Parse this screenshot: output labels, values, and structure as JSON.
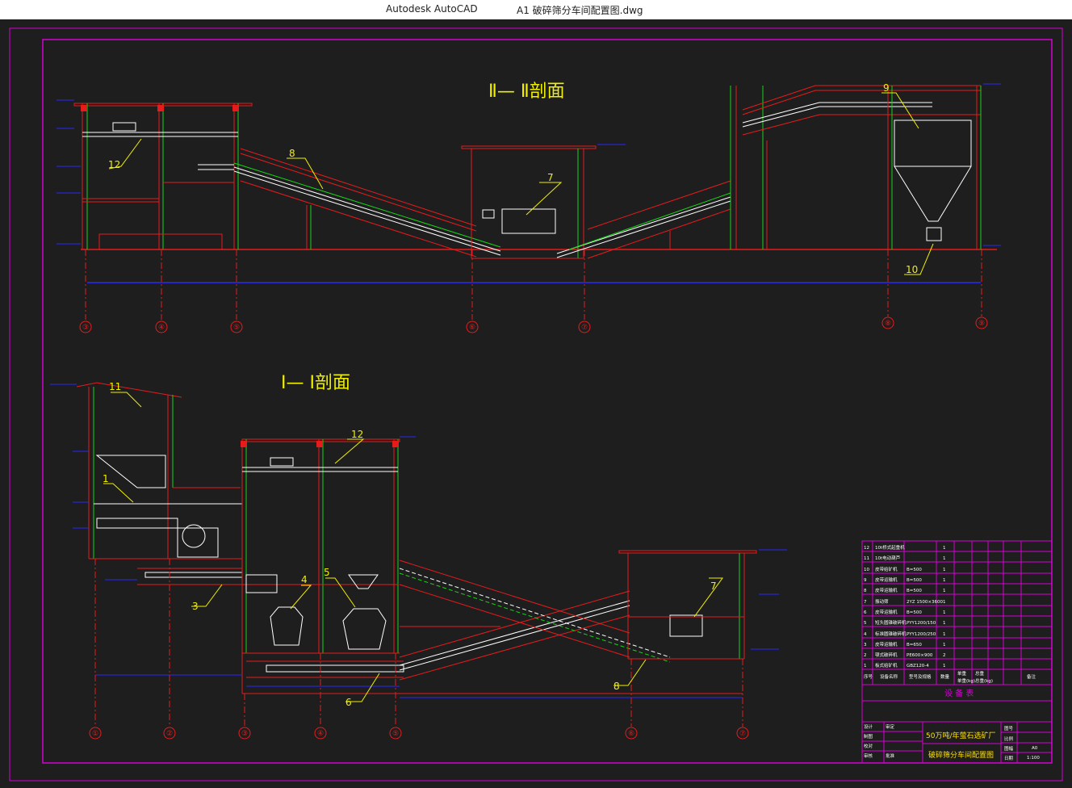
{
  "window": {
    "app_name": "Autodesk AutoCAD",
    "document_title": "A1  破碎筛分车间配置图.dwg"
  },
  "colors": {
    "background": "#1e1e1e",
    "frame": "#d600d6",
    "structure": "#e61c1c",
    "conveyor": "#ffffff",
    "green": "#17d417",
    "blue": "#2828ff",
    "label": "#f0f000"
  },
  "drawing": {
    "section_2": {
      "title": "Ⅱ— Ⅱ剖面",
      "axes": [
        "③",
        "④",
        "⑤",
        "⑥",
        "⑦",
        "⑧",
        "⑨"
      ],
      "callouts": [
        "12",
        "8",
        "7",
        "9",
        "10"
      ]
    },
    "section_1": {
      "title": "Ⅰ— Ⅰ剖面",
      "axes": [
        "①",
        "②",
        "③",
        "④",
        "⑤",
        "⑥",
        "⑦"
      ],
      "callouts": [
        "11",
        "1",
        "12",
        "3",
        "4",
        "5",
        "6",
        "7",
        "8"
      ]
    },
    "equipment_table": {
      "rows": [
        {
          "no": "12",
          "name": "10t桥式起重机",
          "spec": "",
          "qty": "1"
        },
        {
          "no": "11",
          "name": "10t电动葫芦",
          "spec": "",
          "qty": "1"
        },
        {
          "no": "10",
          "name": "皮带给矿机",
          "spec": "B=500",
          "qty": "1"
        },
        {
          "no": "9",
          "name": "皮带运输机",
          "spec": "B=500",
          "qty": "1"
        },
        {
          "no": "8",
          "name": "皮带运输机",
          "spec": "B=500",
          "qty": "1"
        },
        {
          "no": "7",
          "name": "振动筛",
          "spec": "2YZ 1500×3600",
          "qty": "1"
        },
        {
          "no": "6",
          "name": "皮带运输机",
          "spec": "B=500",
          "qty": "1"
        },
        {
          "no": "5",
          "name": "短头圆锥破碎机",
          "spec": "PYY1200/150",
          "qty": "1"
        },
        {
          "no": "4",
          "name": "标准圆锥破碎机",
          "spec": "PYY1200/250",
          "qty": "1"
        },
        {
          "no": "3",
          "name": "皮带运输机",
          "spec": "B=650",
          "qty": "1"
        },
        {
          "no": "2",
          "name": "颚式破碎机",
          "spec": "PE600×900",
          "qty": "2"
        },
        {
          "no": "1",
          "name": "板式给矿机",
          "spec": "GBZ120-4",
          "qty": "1"
        }
      ],
      "header_cells": [
        "序号",
        "设备名称",
        "型号及规格",
        "数量",
        "单重",
        "总重",
        "备注"
      ],
      "weight_labels": [
        "单重(kg)",
        "总重(kg)"
      ],
      "title": "设 备 表"
    },
    "title_block": {
      "project": "50万吨/年萤石选矿厂",
      "drawing_name": "破碎筛分车间配置图",
      "scale": "1:100",
      "sheet": "A0",
      "role_labels": [
        "设计",
        "制图",
        "校对",
        "审核",
        "审定",
        "批准"
      ],
      "field_labels": [
        "图号",
        "比例",
        "图幅",
        "日期"
      ]
    }
  }
}
